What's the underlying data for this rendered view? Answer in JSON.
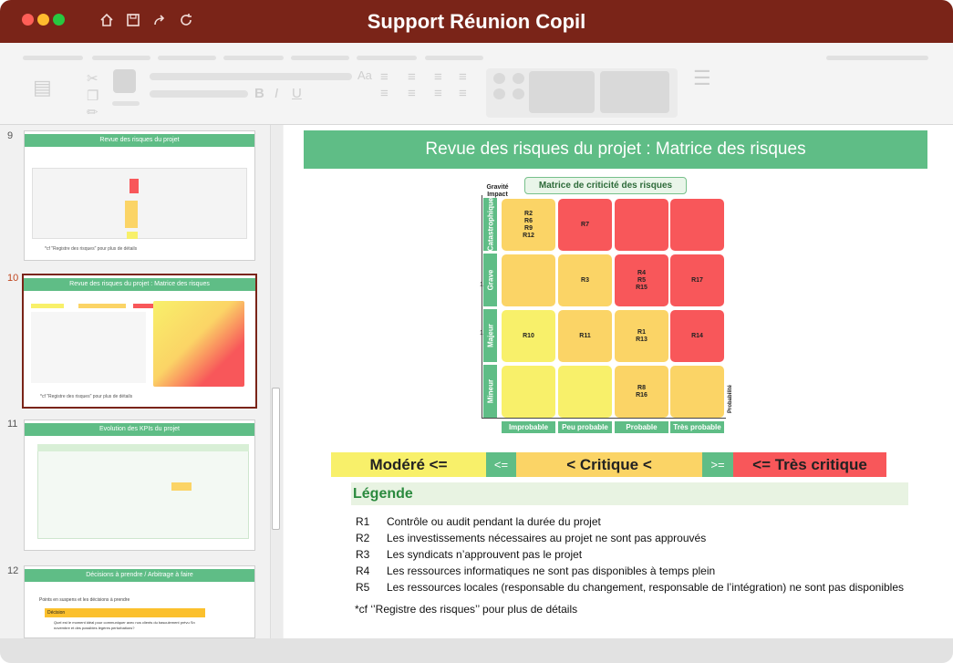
{
  "window": {
    "title": "Support Réunion Copil",
    "title_bar_color": "#7a2418",
    "traffic_lights": [
      "#ff5f57",
      "#febc2e",
      "#28c840"
    ],
    "toolbar_icons": [
      "home-icon",
      "save-icon",
      "share-icon",
      "refresh-icon"
    ]
  },
  "thumbnails": [
    {
      "number": "9",
      "title": "Revue des risques du projet",
      "footnote": "*cf \"Registre des risques\" pour plus de détails",
      "selected": false
    },
    {
      "number": "10",
      "title": "Revue des risques du projet : Matrice des risques",
      "footnote": "*cf \"Registre des risques\" pour plus de détails",
      "selected": true
    },
    {
      "number": "11",
      "title": "Evolution des KPIs du projet",
      "selected": false
    },
    {
      "number": "12",
      "title": "Décisions à prendre / Arbitrage à faire",
      "subtitle": "Points en suspens et les décisions à prendre",
      "decision_label": "Décision",
      "decision_text": "Quel est le moment idéal pour communiquer avec nos clients du basculement prévu Sn novembre et des possibles légères perturbations?",
      "selected": false
    }
  ],
  "slide": {
    "title": "Revue des risques du projet : Matrice des risques",
    "accent_color": "#5fbd86",
    "matrix": {
      "title": "Matrice de criticité des risques",
      "y_axis_label": "Gravité\nImpact",
      "x_axis_label": "Probabilité",
      "rows": [
        "Catastrophique",
        "Grave",
        "Majeur",
        "Mineur"
      ],
      "columns": [
        "Improbable",
        "Peu probable",
        "Probable",
        "Très probable"
      ],
      "row_tick": "1",
      "cells": [
        [
          "R2\nR6\nR9\nR12",
          "R7",
          "",
          ""
        ],
        [
          "",
          "R3",
          "R4\nR5\nR15",
          "R17"
        ],
        [
          "R10",
          "R11",
          "R1\nR13",
          "R14"
        ],
        [
          "",
          "",
          "R8\nR16",
          ""
        ]
      ],
      "cell_colors": [
        [
          "#fbd466",
          "#f8575a",
          "#f8575a",
          "#f8575a"
        ],
        [
          "#fbd466",
          "#fbd466",
          "#f8575a",
          "#f8575a"
        ],
        [
          "#f8f06a",
          "#fbd466",
          "#fbd466",
          "#f8575a"
        ],
        [
          "#f8f06a",
          "#f8f06a",
          "#fbd466",
          "#fbd466"
        ]
      ]
    },
    "scale": {
      "moderate": "Modéré <=",
      "sep1": "<=",
      "critical": "< Critique <",
      "sep2": ">=",
      "very_critical": "<= Très critique",
      "colors": {
        "moderate": "#f8f06a",
        "sep": "#5fbd86",
        "critical": "#fbd466",
        "very_critical": "#f8575a"
      }
    },
    "legend": {
      "title": "Légende",
      "items": [
        {
          "code": "R1",
          "text": "Contrôle ou audit pendant la durée du projet"
        },
        {
          "code": "R2",
          "text": "Les investissements nécessaires au projet ne sont pas approuvés"
        },
        {
          "code": "R3",
          "text": "Les syndicats n’approuvent pas le projet"
        },
        {
          "code": "R4",
          "text": "Les ressources informatiques ne sont pas disponibles à temps plein"
        },
        {
          "code": "R5",
          "text": "Les ressources locales (responsable du changement, responsable de l’intégration) ne sont pas disponibles"
        }
      ]
    },
    "footnote": "*cf ‘’Registre des risques’’ pour plus de détails"
  }
}
